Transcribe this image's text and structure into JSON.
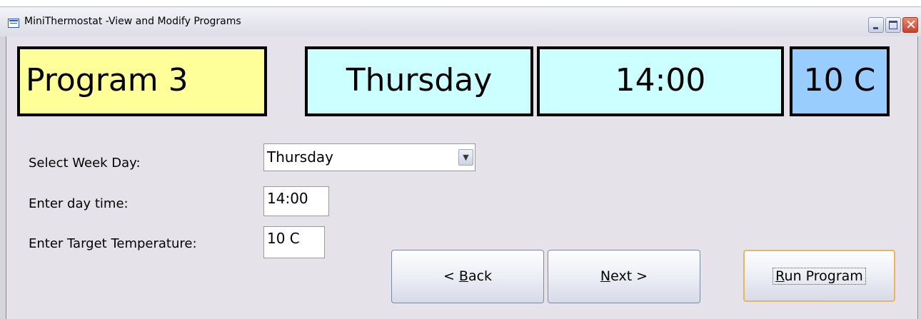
{
  "window": {
    "title": "MiniThermostat -View and Modify Programs"
  },
  "status": {
    "program": "Program 3",
    "day": "Thursday",
    "time": "14:00",
    "temperature": "10 C"
  },
  "form": {
    "week_day_label": "Select Week Day:",
    "week_day_value": "Thursday",
    "day_time_label": "Enter day time:",
    "day_time_value": "14:00",
    "target_temp_label": "Enter Target Temperature:",
    "target_temp_value": "10 C"
  },
  "buttons": {
    "back_prefix": "< ",
    "back_accel": "B",
    "back_rest": "ack",
    "next_accel": "N",
    "next_rest": "ext >",
    "run_accel": "R",
    "run_rest": "un Program"
  },
  "colors": {
    "program_box": "#ffff99",
    "day_time_box": "#ccffff",
    "temperature_box": "#99ccff",
    "form_background": "#e5e3e9"
  },
  "icons": {
    "app": "form-icon",
    "minimize": "minimize-icon",
    "maximize": "maximize-icon",
    "close": "close-icon",
    "dropdown": "chevron-down-icon"
  }
}
